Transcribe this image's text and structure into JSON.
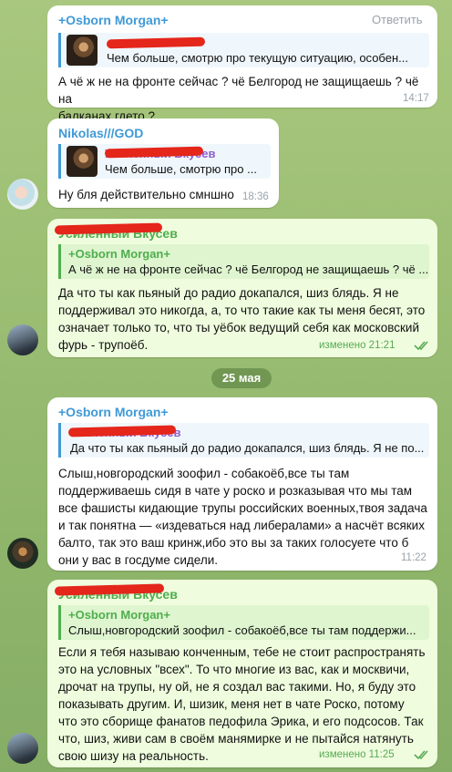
{
  "chat": {
    "date_separator": "25 мая",
    "reply_button_label": "Ответить",
    "messages": [
      {
        "sender": "+Osborn Morgan+",
        "quote_text": "Чем больше,  смотрю про текущую ситуацию, особен...",
        "text": [
          "А чё ж не на фронте сейчас ? чё Белгород не защищаешь ? чё на",
          "балканах гдето ?"
        ],
        "time": "14:17"
      },
      {
        "sender": "Nikolas///GOD",
        "quote_name": "Усиленный Вкусев",
        "quote_text": "Чем больше,  смотрю про ...",
        "text": [
          "Ну бля действительно смншно"
        ],
        "time": "18:36"
      },
      {
        "sender": "Усиленный Вкусев",
        "quote_name": "+Osborn Morgan+",
        "quote_text": "А чё ж не на фронте сейчас ? чё Белгород не защищаешь ? чё ...",
        "text": [
          "Да что ты как пьяный до радио докапался, шиз блядь. Я не",
          "поддерживал это никогда, а, то что такие как ты меня бесят, это",
          "означает только то, что ты уёбок ведущий себя как московский",
          "фурь - трупоёб."
        ],
        "time": "изменено 21:21"
      },
      {
        "sender": "+Osborn Morgan+",
        "quote_name": "Усиленный Вкусев",
        "quote_text": "Да что ты как пьяный до радио докапался, шиз блядь. Я не по...",
        "text": [
          "Слыш,новгородский зоофил - собакоёб,все ты там",
          "поддерживаешь сидя в чате у роско и розказывая что мы там",
          "все фашисты кидающие трупы российских военных,твоя задача",
          "и так понятна — «издеваться над либералами» а насчёт всяких",
          "балто, так это ваш кринж,ибо это вы за таких голосуете что б",
          "они у вас в госдуме сидели."
        ],
        "time": "11:22"
      },
      {
        "sender": "Усиленный Вкусев",
        "quote_name": "+Osborn Morgan+",
        "quote_text": "Слыш,новгородский зоофил - собакоёб,все ты там поддержи...",
        "text": [
          "Если я тебя называю конченным, тебе не стоит распространять",
          "это на условных \"всех\". То что многие из вас, как и москвичи,",
          "дрочат на трупы, ну ой, не я создал вас  такими. Но, я буду это",
          "показывать другим. И, шизик, меня нет в чате Роско, потому",
          "что это сборище фанатов педофила Эрика, и его подсосов. Так",
          "что, шиз, живи сам в своём манямирке и не пытайся натянуть",
          "свою шизу на реальность."
        ],
        "time": "изменено 11:25"
      }
    ]
  },
  "colors": {
    "blue_name": "#3f9ad6",
    "green_name": "#4fae4e",
    "purple_name": "#8e5fd3",
    "outgoing_bubble": "#effdde",
    "redaction": "#e4261b"
  }
}
